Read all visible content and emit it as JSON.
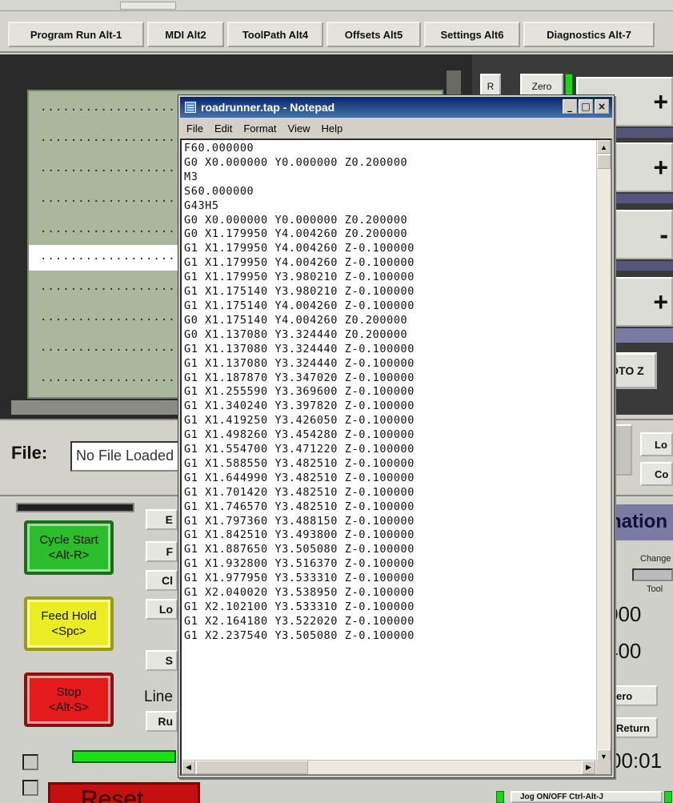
{
  "tabs": [
    {
      "label": "Program Run Alt-1"
    },
    {
      "label": "MDI Alt2"
    },
    {
      "label": "ToolPath Alt4"
    },
    {
      "label": "Offsets Alt5"
    },
    {
      "label": "Settings Alt6"
    },
    {
      "label": "Diagnostics Alt-7"
    }
  ],
  "code_list": {
    "rows": [
      "..................",
      "..................",
      "..................",
      "..................",
      "..................",
      "..................",
      "..................",
      "..................",
      "..................",
      ".................."
    ],
    "selected_index": 5
  },
  "axis_panel": {
    "r_button": "R",
    "zero_button": "Zero",
    "signs": [
      "+",
      "+",
      "-",
      "+"
    ],
    "goto_z": "GOTO Z"
  },
  "file": {
    "label": "File:",
    "value": "No File Loaded",
    "load_button": "Lo",
    "close_button": "Co"
  },
  "controls": {
    "cycle_start": {
      "line1": "Cycle Start",
      "line2": "<Alt-R>"
    },
    "feed_hold": {
      "line1": "Feed Hold",
      "line2": "<Spc>"
    },
    "stop": {
      "line1": "Stop",
      "line2": "<Alt-S>"
    },
    "small_buttons": [
      "E",
      "F",
      "Cl",
      "Lo",
      "S",
      "Ru"
    ],
    "line_label": "Line",
    "reset": "Reset"
  },
  "right_lower": {
    "nation_tab": "nation",
    "change_label": "Change",
    "tool_label": "Tool",
    "values": [
      "000",
      "400"
    ],
    "zero_button": "ero",
    "return_button": "Return",
    "timer": "00:01",
    "jog_button": "Jog ON/OFF Ctrl-Alt-J"
  },
  "notepad": {
    "title": "roadrunner.tap - Notepad",
    "menu": [
      "File",
      "Edit",
      "Format",
      "View",
      "Help"
    ],
    "lines": [
      "F60.000000",
      "G0 X0.000000 Y0.000000 Z0.200000",
      "M3",
      "S60.000000",
      "G43H5",
      "G0 X0.000000 Y0.000000 Z0.200000",
      "G0 X1.179950 Y4.004260 Z0.200000",
      "G1 X1.179950 Y4.004260 Z-0.100000",
      "G1 X1.179950 Y4.004260 Z-0.100000",
      "G1 X1.179950 Y3.980210 Z-0.100000",
      "G1 X1.175140 Y3.980210 Z-0.100000",
      "G1 X1.175140 Y4.004260 Z-0.100000",
      "G0 X1.175140 Y4.004260 Z0.200000",
      "G0 X1.137080 Y3.324440 Z0.200000",
      "G1 X1.137080 Y3.324440 Z-0.100000",
      "G1 X1.137080 Y3.324440 Z-0.100000",
      "G1 X1.187870 Y3.347020 Z-0.100000",
      "G1 X1.255590 Y3.369600 Z-0.100000",
      "G1 X1.340240 Y3.397820 Z-0.100000",
      "G1 X1.419250 Y3.426050 Z-0.100000",
      "G1 X1.498260 Y3.454280 Z-0.100000",
      "G1 X1.554700 Y3.471220 Z-0.100000",
      "G1 X1.588550 Y3.482510 Z-0.100000",
      "G1 X1.644990 Y3.482510 Z-0.100000",
      "G1 X1.701420 Y3.482510 Z-0.100000",
      "G1 X1.746570 Y3.482510 Z-0.100000",
      "G1 X1.797360 Y3.488150 Z-0.100000",
      "G1 X1.842510 Y3.493800 Z-0.100000",
      "G1 X1.887650 Y3.505080 Z-0.100000",
      "G1 X1.932800 Y3.516370 Z-0.100000",
      "G1 X1.977950 Y3.533310 Z-0.100000",
      "G1 X2.040020 Y3.538950 Z-0.100000",
      "G1 X2.102100 Y3.533310 Z-0.100000",
      "G1 X2.164180 Y3.522020 Z-0.100000",
      "G1 X2.237540 Y3.505080 Z-0.100000"
    ]
  }
}
